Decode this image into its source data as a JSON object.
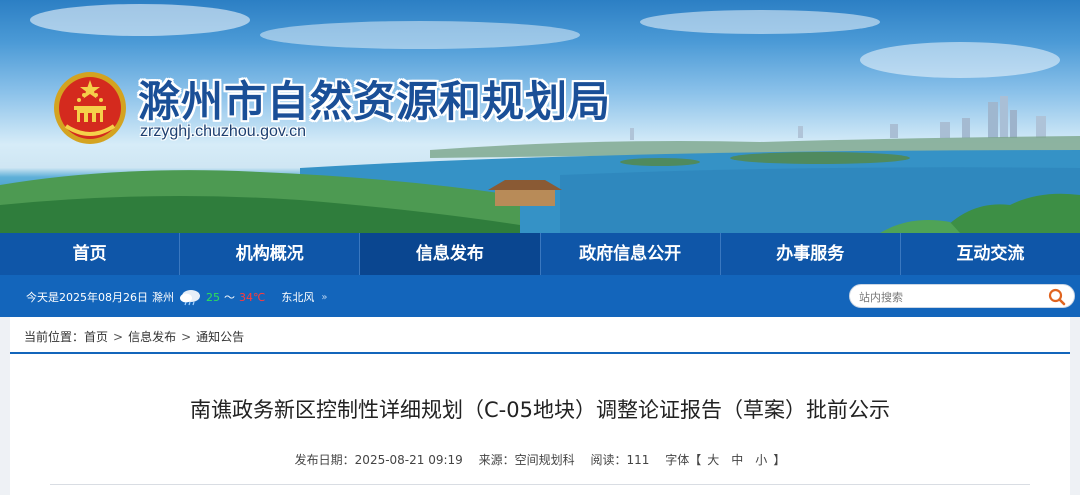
{
  "header": {
    "site_title": "滁州市自然资源和规划局",
    "site_domain": "zrzyghj.chuzhou.gov.cn",
    "emblem_icon": "national-emblem-icon"
  },
  "nav": {
    "items": [
      {
        "label": "首页"
      },
      {
        "label": "机构概况"
      },
      {
        "label": "信息发布"
      },
      {
        "label": "政府信息公开"
      },
      {
        "label": "办事服务"
      },
      {
        "label": "互动交流"
      }
    ],
    "active_index": 2,
    "color": "#0f56a8"
  },
  "infobar": {
    "date_text": "今天是2025年08月26日",
    "city": "滁州",
    "weather_icon": "rain-cloud-icon",
    "temp_low": "25",
    "temp_sep": "～",
    "temp_high": "34℃",
    "wind": "东北风",
    "search_placeholder": "站内搜索"
  },
  "breadcrumb": {
    "prefix": "当前位置：",
    "items": [
      "首页",
      "信息发布",
      "通知公告"
    ],
    "separator": ">"
  },
  "article": {
    "title": "南谯政务新区控制性详细规划（C-05地块）调整论证报告（草案）批前公示",
    "publish_label": "发布日期：",
    "publish_date": "2025-08-21 09:19",
    "source_label": "来源：",
    "source": "空间规划科",
    "reads_label": "阅读：",
    "reads": "111",
    "fontsize_label": "字体【",
    "fontsize_options": [
      "大",
      "中",
      "小"
    ],
    "fontsize_close": "】"
  }
}
